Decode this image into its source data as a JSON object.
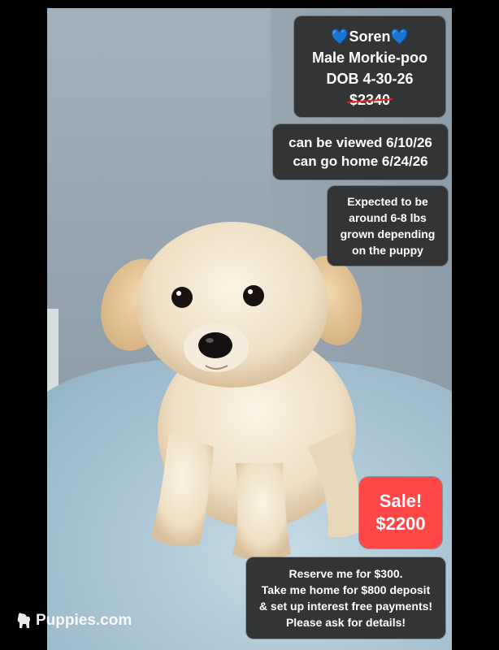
{
  "info_card": {
    "name_line": "💙Soren💙",
    "breed_line": "Male Morkie-poo",
    "dob_line": "DOB 4-30-26",
    "old_price": "$2340"
  },
  "dates_card": {
    "line1": "can be viewed 6/10/26",
    "line2": "can go home 6/24/26"
  },
  "size_card": {
    "line1": "Expected to be",
    "line2": "around 6-8 lbs",
    "line3": "grown depending",
    "line4": "on the puppy"
  },
  "sale_card": {
    "label": "Sale!",
    "price": "$2200",
    "color": "#ff4747"
  },
  "reserve_card": {
    "line1": "Reserve me for $300.",
    "line2": "Take me home for $800 deposit",
    "line3": "& set up interest free payments!",
    "line4": "Please ask for details!"
  },
  "watermark": {
    "text": "Puppies.com",
    "icon": "dog-silhouette-icon"
  }
}
